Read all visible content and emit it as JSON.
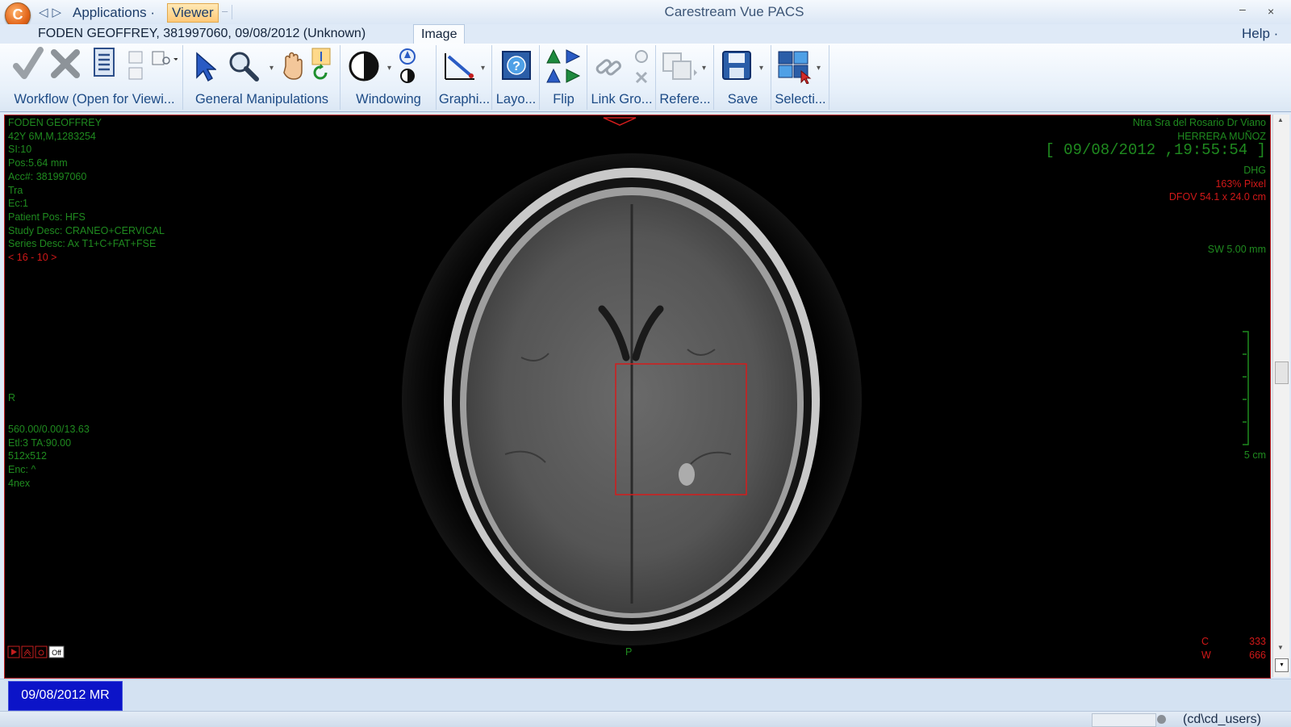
{
  "titlebar": {
    "app_title": "Carestream Vue PACS",
    "menu_applications": "Applications ·",
    "menu_viewer": "Viewer",
    "minimize": "–",
    "close": "×"
  },
  "header": {
    "patient_line": "FODEN GEOFFREY, 381997060, 09/08/2012 (Unknown)",
    "image_tab": "Image",
    "help": "Help ·"
  },
  "ribbon": {
    "groups": [
      {
        "label": "Workflow (Open for Viewi..."
      },
      {
        "label": "General Manipulations"
      },
      {
        "label": "Windowing"
      },
      {
        "label": "Graphi..."
      },
      {
        "label": "Layo..."
      },
      {
        "label": "Flip"
      },
      {
        "label": "Link Gro..."
      },
      {
        "label": "Refere..."
      },
      {
        "label": "Save"
      },
      {
        "label": "Selecti..."
      }
    ]
  },
  "overlay": {
    "top_left": [
      "FODEN GEOFFREY",
      "42Y 6M,M,1283254",
      "SI:10",
      "Pos:5.64 mm",
      "Acc#: 381997060",
      "Tra",
      "Ec:1",
      "Patient Pos: HFS",
      "Study Desc: CRANEO+CERVICAL",
      "Series Desc: Ax T1+C+FAT+FSE"
    ],
    "slice_nav": "< 16 - 10 >",
    "orientation_left": "R",
    "orientation_bottom": "P",
    "bottom_left": [
      "560.00/0.00/13.63",
      "Etl:3 TA:90.00",
      "512x512",
      "Enc: ^",
      "4nex"
    ],
    "institution": "Ntra Sra del Rosario Dr Viano",
    "physician": "HERRERA MUÑOZ",
    "timestamp": "[ 09/08/2012 ,19:55:54 ]",
    "station": "DHG",
    "zoom": "163% Pixel",
    "dfov": "DFOV 54.1 x 24.0 cm",
    "slice_width": "SW 5.00 mm",
    "scale_label": "5 cm",
    "window_center_label": "C",
    "window_center_value": "333",
    "window_width_label": "W",
    "window_width_value": "666"
  },
  "study_bar": {
    "study_button": "09/08/2012 MR"
  },
  "status_bar": {
    "user": "(cd\\cd_users)"
  }
}
